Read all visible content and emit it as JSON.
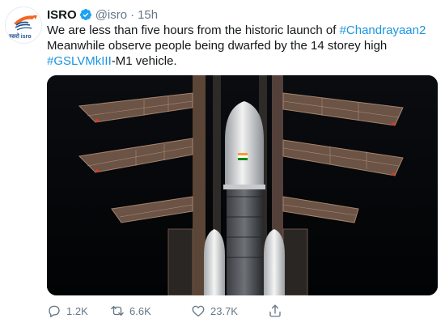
{
  "tweet": {
    "name": "ISRO",
    "handle": "@isro",
    "separator": "·",
    "time": "15h",
    "avatar_text": "इसरो isro",
    "text": {
      "line1_plain": "We are less than five hours from the historic launch of ",
      "line1_hashtag": "#Chandrayaan2",
      "line2_plain": "Meanwhile observe people being dwarfed by the 14 storey high",
      "line3_hashtag": "#GSLVMkIII",
      "line3_plain": "-M1 vehicle."
    },
    "media": {
      "description_icon": "rocket-launch-photo"
    }
  },
  "actions": {
    "reply": {
      "icon": "reply-icon",
      "count": "1.2K"
    },
    "retweet": {
      "icon": "retweet-icon",
      "count": "6.6K"
    },
    "like": {
      "icon": "heart-icon",
      "count": "23.7K"
    },
    "share": {
      "icon": "share-icon"
    }
  },
  "colors": {
    "link": "#1b95e0",
    "muted": "#657786",
    "verified": "#1da1f2",
    "isro_orange": "#f26722",
    "isro_blue": "#1b4d8f"
  }
}
